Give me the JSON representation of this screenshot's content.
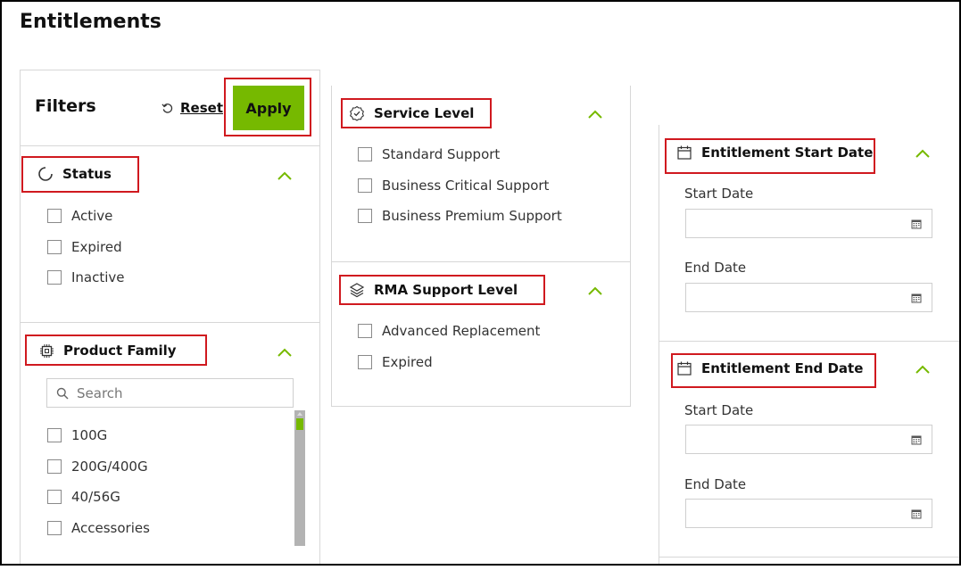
{
  "page": {
    "title": "Entitlements"
  },
  "filters": {
    "title": "Filters",
    "reset_label": "Reset",
    "apply_label": "Apply"
  },
  "status": {
    "title": "Status",
    "options": [
      "Active",
      "Expired",
      "Inactive"
    ]
  },
  "product_family": {
    "title": "Product Family",
    "search_placeholder": "Search",
    "options": [
      "100G",
      "200G/400G",
      "40/56G",
      "Accessories"
    ]
  },
  "service_level": {
    "title": "Service Level",
    "options": [
      "Standard Support",
      "Business Critical Support",
      "Business Premium Support"
    ]
  },
  "rma_support_level": {
    "title": "RMA Support Level",
    "options": [
      "Advanced Replacement",
      "Expired"
    ]
  },
  "entitlement_start_date": {
    "title": "Entitlement Start Date",
    "start_label": "Start Date",
    "end_label": "End Date",
    "start_value": "",
    "end_value": ""
  },
  "entitlement_end_date": {
    "title": "Entitlement End Date",
    "start_label": "Start Date",
    "end_label": "End Date",
    "start_value": "",
    "end_value": ""
  },
  "colors": {
    "accent": "#76b900",
    "highlight": "#d0191f",
    "border": "#d7d7d7"
  }
}
